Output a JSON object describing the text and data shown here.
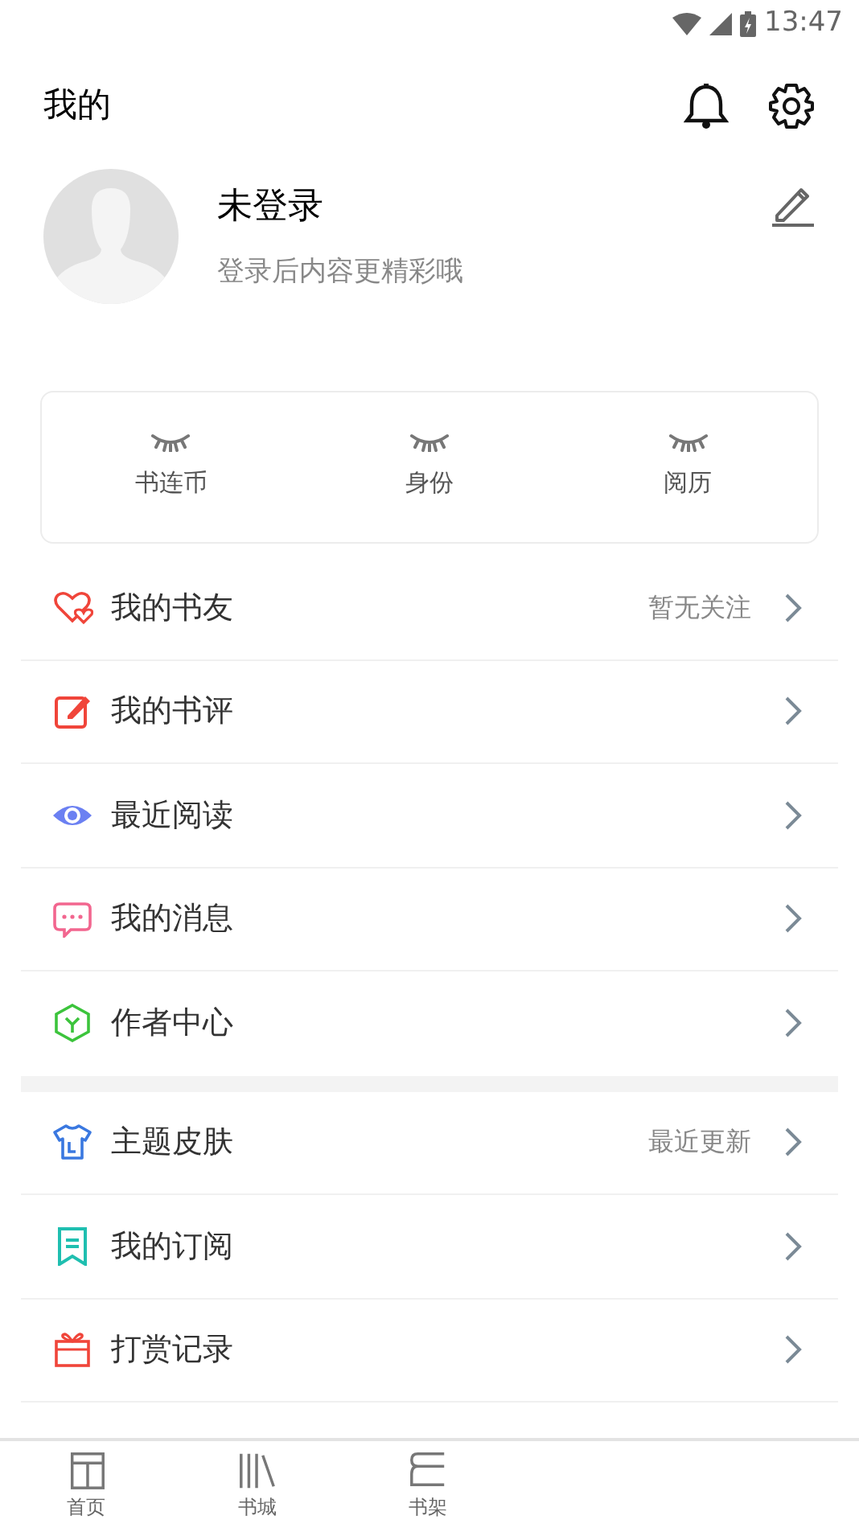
{
  "status_bar": {
    "time": "13:47"
  },
  "header": {
    "title": "我的"
  },
  "profile": {
    "name": "未登录",
    "subtitle": "登录后内容更精彩哦"
  },
  "stats": [
    {
      "label": "书连币"
    },
    {
      "label": "身份"
    },
    {
      "label": "阅历"
    }
  ],
  "menu_groups": [
    [
      {
        "label": "我的书友",
        "detail": "暂无关注",
        "color": "#f0453a"
      },
      {
        "label": "我的书评",
        "color": "#f0453a"
      },
      {
        "label": "最近阅读",
        "color": "#6b80f2"
      },
      {
        "label": "我的消息",
        "color": "#f2668f"
      },
      {
        "label": "作者中心",
        "color": "#3cc43c"
      }
    ],
    [
      {
        "label": "主题皮肤",
        "detail": "最近更新",
        "color": "#3a78e0"
      },
      {
        "label": "我的订阅",
        "color": "#1fbfb0"
      },
      {
        "label": "打赏记录",
        "color": "#f0453a"
      }
    ]
  ],
  "bottom_nav": [
    {
      "label": "首页",
      "selected": false
    },
    {
      "label": "书城",
      "selected": false
    },
    {
      "label": "书架",
      "selected": false
    }
  ]
}
